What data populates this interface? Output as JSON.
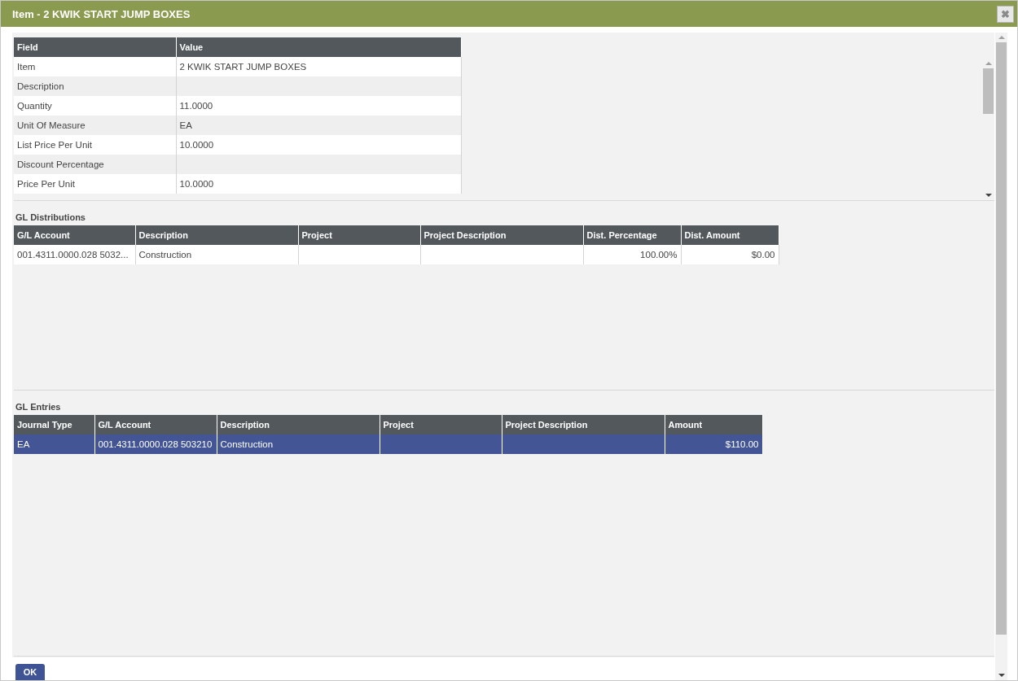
{
  "window": {
    "title": "Item - 2 KWIK START JUMP BOXES",
    "close": "✖"
  },
  "properties": {
    "columns": [
      "Field",
      "Value"
    ],
    "rows": [
      {
        "field": "Item",
        "value": "2 KWIK START JUMP BOXES"
      },
      {
        "field": "Description",
        "value": ""
      },
      {
        "field": "Quantity",
        "value": "11.0000"
      },
      {
        "field": "Unit Of Measure",
        "value": "EA"
      },
      {
        "field": "List Price Per Unit",
        "value": "10.0000"
      },
      {
        "field": "Discount Percentage",
        "value": ""
      },
      {
        "field": "Price Per Unit",
        "value": "10.0000"
      }
    ]
  },
  "gl_distributions": {
    "title": "GL Distributions",
    "columns": [
      {
        "label": "G/L Account",
        "numeric": false
      },
      {
        "label": "Description",
        "numeric": false
      },
      {
        "label": "Project"
      },
      {
        "label": "Project Description"
      },
      {
        "label": "Dist. Percentage",
        "numeric": true
      },
      {
        "label": "Dist. Amount",
        "numeric": true
      }
    ],
    "rows": [
      {
        "selected": false,
        "cells": [
          "001.4311.0000.028 5032...",
          "Construction",
          "",
          "",
          "100.00%",
          "$0.00"
        ]
      }
    ]
  },
  "gl_entries": {
    "title": "GL Entries",
    "columns": [
      {
        "label": "Journal Type",
        "numeric": false
      },
      {
        "label": "G/L Account",
        "numeric": false
      },
      {
        "label": "Description",
        "numeric": false
      },
      {
        "label": "Project"
      },
      {
        "label": "Project Description"
      },
      {
        "label": "Amount",
        "numeric": true
      }
    ],
    "rows": [
      {
        "selected": true,
        "cells": [
          "EA",
          "001.4311.0000.028 503210",
          "Construction",
          "",
          "",
          "$110.00"
        ]
      }
    ]
  },
  "buttons": [
    "OK"
  ]
}
